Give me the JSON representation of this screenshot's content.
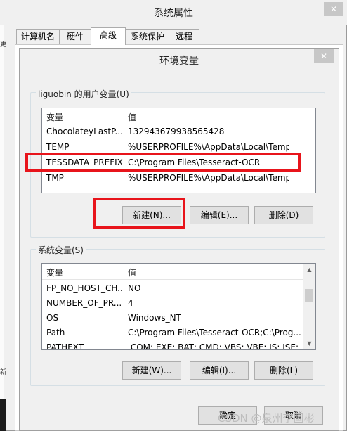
{
  "outer_window": {
    "title": "系统属性",
    "close_glyph": "✕",
    "tabs": [
      {
        "label": "计算机名"
      },
      {
        "label": "硬件"
      },
      {
        "label": "高级"
      },
      {
        "label": "系统保护"
      },
      {
        "label": "远程"
      }
    ],
    "left_glyph_top": "更",
    "left_glyph_bottom": "新"
  },
  "env_dialog": {
    "title": "环境变量",
    "close_glyph": "✕",
    "user_section": {
      "label": "liguobin 的用户变量(U)",
      "columns": [
        "变量",
        "值"
      ],
      "rows": [
        {
          "name": "ChocolateyLastP...",
          "value": "132943679938565428"
        },
        {
          "name": "TEMP",
          "value": "%USERPROFILE%\\AppData\\Local\\Temp"
        },
        {
          "name": "TESSDATA_PREFIX",
          "value": "C:\\Program Files\\Tesseract-OCR"
        },
        {
          "name": "TMP",
          "value": "%USERPROFILE%\\AppData\\Local\\Temp"
        }
      ],
      "buttons": {
        "new": "新建(N)...",
        "edit": "编辑(E)...",
        "delete": "删除(D)"
      }
    },
    "system_section": {
      "label": "系统变量(S)",
      "columns": [
        "变量",
        "值"
      ],
      "rows": [
        {
          "name": "FP_NO_HOST_CH...",
          "value": "NO"
        },
        {
          "name": "NUMBER_OF_PR...",
          "value": "4"
        },
        {
          "name": "OS",
          "value": "Windows_NT"
        },
        {
          "name": "Path",
          "value": "C:\\Program Files\\Tesseract-OCR;C:\\Prog..."
        },
        {
          "name": "PATHEXT",
          "value": ".COM;.EXE;.BAT;.CMD;.VBS;.VBE;.JS;.JSE;"
        }
      ],
      "buttons": {
        "new": "新建(W)...",
        "edit": "编辑(I)...",
        "delete": "删除(L)"
      }
    },
    "footer_buttons": {
      "ok": "确定",
      "cancel": "取消"
    }
  },
  "watermark": "CSDN @泉州李国彬",
  "colors": {
    "highlight_red": "#e8141b",
    "button_face": "#e1e1e1",
    "dialog_bg": "#f0f0f0"
  }
}
